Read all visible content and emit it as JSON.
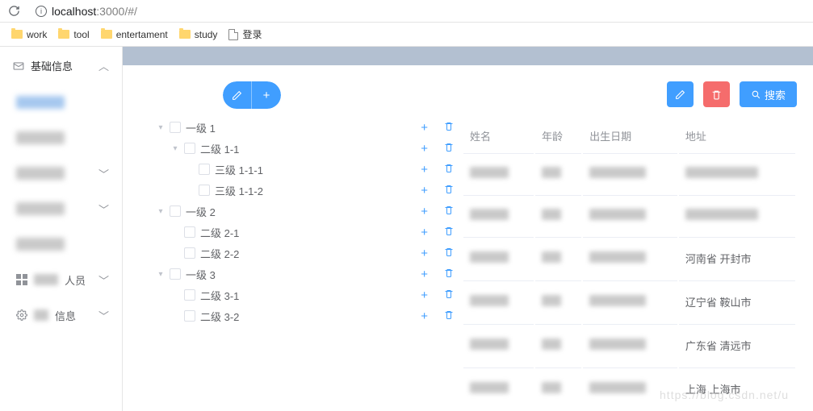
{
  "browser": {
    "url_host": "localhost",
    "url_port": ":3000",
    "url_path": "/#/",
    "bookmarks": [
      {
        "label": "work",
        "type": "folder"
      },
      {
        "label": "tool",
        "type": "folder"
      },
      {
        "label": "entertament",
        "type": "folder"
      },
      {
        "label": "study",
        "type": "folder"
      },
      {
        "label": "登录",
        "type": "page"
      }
    ]
  },
  "sidebar": {
    "group_label": "基础信息",
    "items": [
      {
        "label": "",
        "expandable": false
      },
      {
        "label": "",
        "expandable": false
      },
      {
        "label": "",
        "expandable": true
      },
      {
        "label": "",
        "expandable": true
      },
      {
        "label": "",
        "expandable": false
      },
      {
        "label": "人员",
        "expandable": true,
        "icon": "grid"
      },
      {
        "label": "信息",
        "expandable": true,
        "icon": "gear"
      }
    ]
  },
  "tree": {
    "nodes": [
      {
        "label": "一级 1",
        "level": 0,
        "expanded": true
      },
      {
        "label": "二级 1-1",
        "level": 1,
        "expanded": true
      },
      {
        "label": "三级 1-1-1",
        "level": 2,
        "expanded": false
      },
      {
        "label": "三级 1-1-2",
        "level": 2,
        "expanded": false
      },
      {
        "label": "一级 2",
        "level": 0,
        "expanded": true
      },
      {
        "label": "二级 2-1",
        "level": 1,
        "expanded": false
      },
      {
        "label": "二级 2-2",
        "level": 1,
        "expanded": false
      },
      {
        "label": "一级 3",
        "level": 0,
        "expanded": true
      },
      {
        "label": "二级 3-1",
        "level": 1,
        "expanded": false
      },
      {
        "label": "二级 3-2",
        "level": 1,
        "expanded": false
      }
    ]
  },
  "table": {
    "toolbar": {
      "edit_label": "",
      "delete_label": "",
      "search_label": "搜索"
    },
    "columns": [
      "姓名",
      "年龄",
      "出生日期",
      "地址"
    ],
    "rows": [
      {
        "name": "",
        "age": "",
        "birth": "",
        "addr": ""
      },
      {
        "name": "",
        "age": "",
        "birth": "",
        "addr": ""
      },
      {
        "name": "",
        "age": "",
        "birth": "",
        "addr": "河南省 开封市"
      },
      {
        "name": "",
        "age": "",
        "birth": "",
        "addr": "辽宁省 鞍山市"
      },
      {
        "name": "",
        "age": "",
        "birth": "",
        "addr": "广东省 清远市"
      },
      {
        "name": "",
        "age": "",
        "birth": "",
        "addr": "上海 上海市"
      }
    ]
  },
  "watermark": "https://blog.csdn.net/u"
}
